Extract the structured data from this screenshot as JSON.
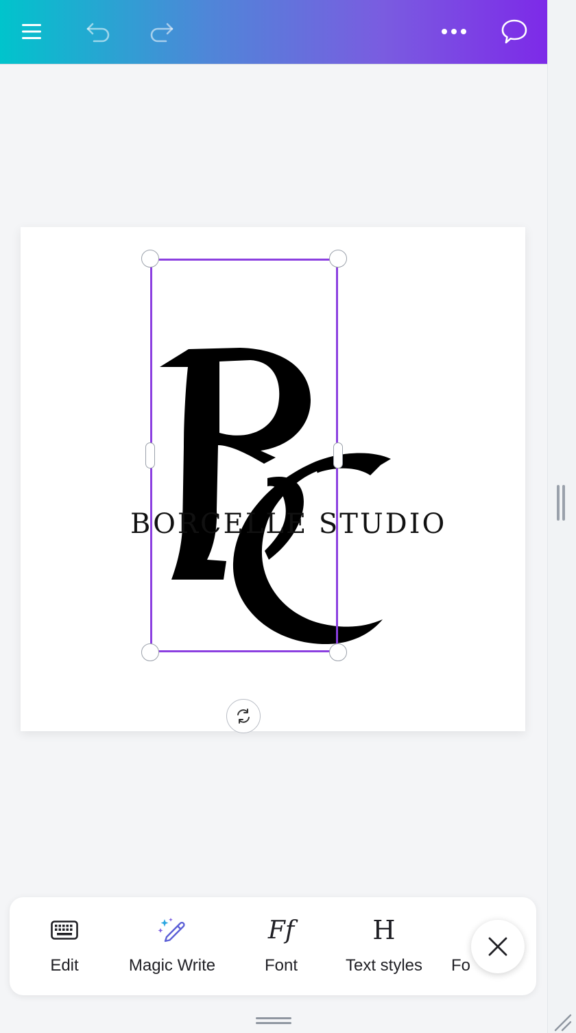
{
  "topbar": {
    "menu_icon": "hamburger-menu-icon",
    "undo_icon": "undo-icon",
    "redo_icon": "redo-icon",
    "more_icon": "more-dots-icon",
    "comment_icon": "comment-bubble-icon"
  },
  "canvas": {
    "logo_text": "BORCELLE STUDIO",
    "rotate_icon": "rotate-icon"
  },
  "toolbar": {
    "items": [
      {
        "label": "Edit",
        "icon": "keyboard-icon"
      },
      {
        "label": "Magic Write",
        "icon": "magic-pen-icon"
      },
      {
        "label": "Font",
        "icon": "font-icon"
      },
      {
        "label": "Text styles",
        "icon": "text-styles-icon"
      },
      {
        "label": "Fo",
        "icon": ""
      }
    ],
    "font_glyph": "Ff",
    "text_styles_glyph": "H",
    "close_icon": "close-icon"
  },
  "colors": {
    "selection": "#8b3fe0",
    "gradient_start": "#00c4cc",
    "gradient_end": "#7d2ae8"
  }
}
